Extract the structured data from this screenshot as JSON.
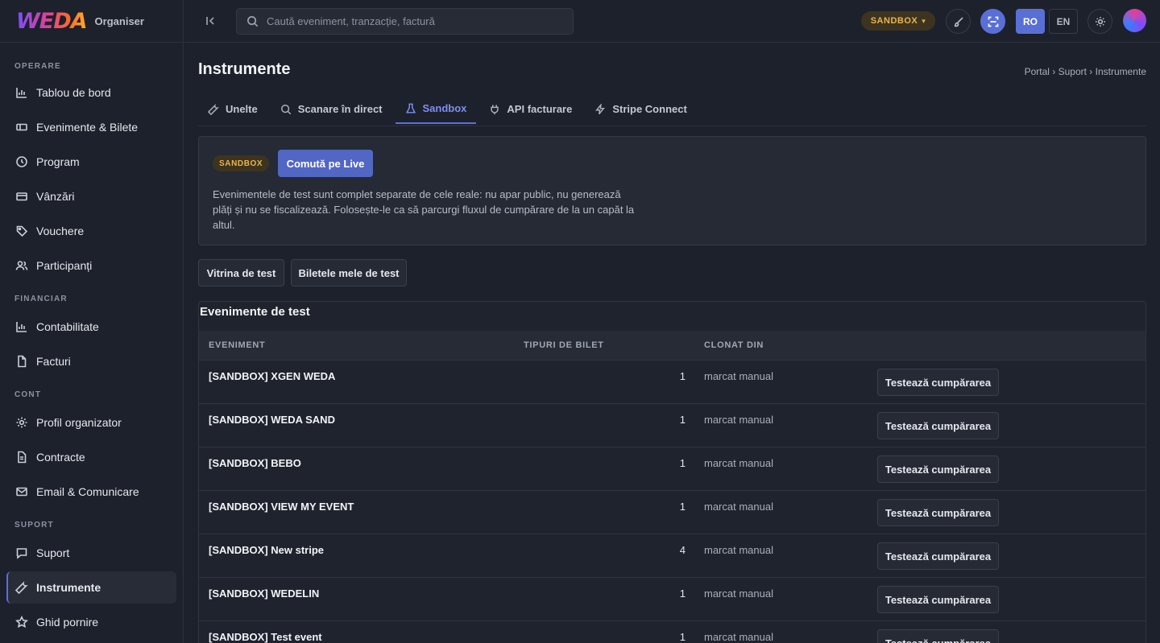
{
  "brand": {
    "logo_text": "WEDA",
    "subtitle": "Organiser"
  },
  "sidebar": {
    "sections": [
      {
        "label": "OPERARE",
        "items": [
          {
            "label": "Tablou de bord",
            "icon": "bar-chart-icon"
          },
          {
            "label": "Evenimente & Bilete",
            "icon": "ticket-icon"
          },
          {
            "label": "Program",
            "icon": "clock-icon"
          },
          {
            "label": "Vânzări",
            "icon": "credit-card-icon"
          },
          {
            "label": "Vouchere",
            "icon": "tag-icon"
          },
          {
            "label": "Participanți",
            "icon": "users-icon"
          }
        ]
      },
      {
        "label": "FINANCIAR",
        "items": [
          {
            "label": "Contabilitate",
            "icon": "bar-chart-icon"
          },
          {
            "label": "Facturi",
            "icon": "file-icon"
          }
        ]
      },
      {
        "label": "CONT",
        "items": [
          {
            "label": "Profil organizator",
            "icon": "gear-icon"
          },
          {
            "label": "Contracte",
            "icon": "document-icon"
          },
          {
            "label": "Email & Comunicare",
            "icon": "mail-icon"
          }
        ]
      },
      {
        "label": "SUPORT",
        "items": [
          {
            "label": "Suport",
            "icon": "chat-icon"
          },
          {
            "label": "Instrumente",
            "icon": "wrench-icon",
            "active": true
          },
          {
            "label": "Ghid pornire",
            "icon": "star-icon"
          }
        ]
      }
    ]
  },
  "topbar": {
    "search_placeholder": "Caută eveniment, tranzacție, factură",
    "env_pill": "SANDBOX",
    "lang_ro": "RO",
    "lang_en": "EN",
    "accent_color": "#5a6fd6",
    "sandbox_color": "#e9b54a"
  },
  "page": {
    "title": "Instrumente",
    "breadcrumb": "Portal › Suport › Instrumente",
    "tabs": [
      {
        "label": "Unelte",
        "icon": "wrench-icon"
      },
      {
        "label": "Scanare în direct",
        "icon": "search-icon"
      },
      {
        "label": "Sandbox",
        "icon": "flask-icon",
        "active": true
      },
      {
        "label": "API facturare",
        "icon": "plug-icon"
      },
      {
        "label": "Stripe Connect",
        "icon": "lightning-icon"
      }
    ]
  },
  "sandbox_card": {
    "badge": "SANDBOX",
    "switch_button": "Comută pe Live",
    "description": "Evenimentele de test sunt complet separate de cele reale: nu apar public, nu generează plăți și nu se fiscalizează. Folosește-le ca să parcurgi fluxul de cumpărare de la un capăt la altul."
  },
  "actions": {
    "storefront": "Vitrina de test",
    "my_tickets": "Biletele mele de test"
  },
  "events": {
    "title": "Evenimente de test",
    "columns": {
      "event": "EVENIMENT",
      "ticket_types": "TIPURI DE BILET",
      "cloned_from": "CLONAT DIN"
    },
    "rows": [
      {
        "name": "[SANDBOX] XGEN WEDA",
        "ticket_types": "1",
        "cloned_from": "marcat manual",
        "action": "Testează cumpărarea"
      },
      {
        "name": "[SANDBOX] WEDA SAND",
        "ticket_types": "1",
        "cloned_from": "marcat manual",
        "action": "Testează cumpărarea"
      },
      {
        "name": "[SANDBOX] BEBO",
        "ticket_types": "1",
        "cloned_from": "marcat manual",
        "action": "Testează cumpărarea"
      },
      {
        "name": "[SANDBOX] VIEW MY EVENT",
        "ticket_types": "1",
        "cloned_from": "marcat manual",
        "action": "Testează cumpărarea"
      },
      {
        "name": "[SANDBOX] New stripe",
        "ticket_types": "4",
        "cloned_from": "marcat manual",
        "action": "Testează cumpărarea"
      },
      {
        "name": "[SANDBOX] WEDELIN",
        "ticket_types": "1",
        "cloned_from": "marcat manual",
        "action": "Testează cumpărarea"
      },
      {
        "name": "[SANDBOX] Test event",
        "ticket_types": "1",
        "cloned_from": "marcat manual",
        "action": "Testează cumpărarea"
      }
    ]
  }
}
